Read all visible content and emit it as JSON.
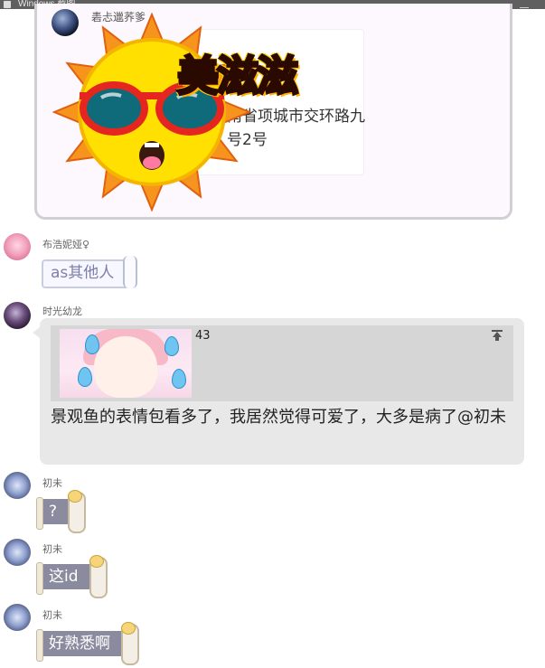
{
  "window": {
    "title": "Windows 截图"
  },
  "top_card": {
    "sender": "砉忐邋荞爹",
    "address_text": "南省项城市交环路九\n号2号",
    "sticker_text": "美滋滋"
  },
  "messages": [
    {
      "id": "m1",
      "sender": "布浩妮娅♀",
      "text": "as其他人"
    },
    {
      "id": "m2",
      "sender": "时光幼龙",
      "quote_count": "43",
      "text": "景观鱼的表情包看多了，我居然觉得可爱了，大多是病了@初未"
    },
    {
      "id": "m3",
      "sender": "初未",
      "text": "?"
    },
    {
      "id": "m4",
      "sender": "初未",
      "text": "这id"
    },
    {
      "id": "m5",
      "sender": "初未",
      "text": "好熟悉啊"
    }
  ],
  "colors": {
    "bubble_gray": "#e8e8e8",
    "scroll_bubble": "#8a8b9e",
    "tag_text": "#7c7fa8",
    "card_bg": "#fdf8fd"
  }
}
